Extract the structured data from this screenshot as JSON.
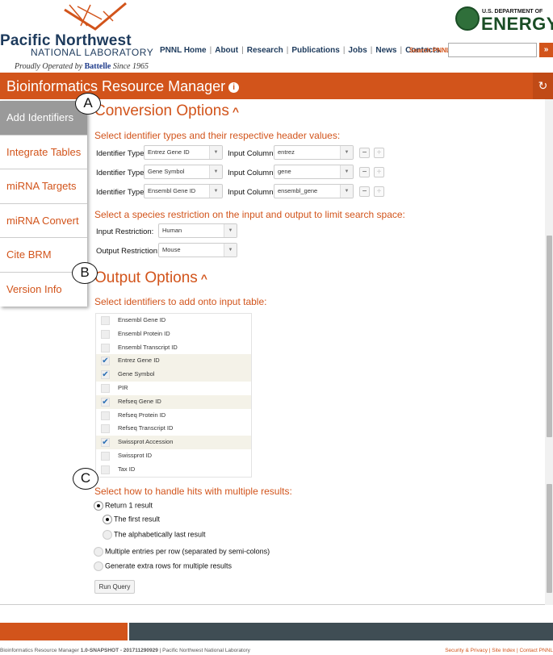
{
  "header": {
    "logo_title": "Pacific Northwest",
    "logo_subtitle": "NATIONAL LABORATORY",
    "operated_prefix": "Proudly Operated by",
    "operated_brand": "Battelle",
    "operated_suffix": "Since 1965",
    "doe_small": "U.S. DEPARTMENT OF",
    "doe_big": "ENERGY",
    "nav": [
      "PNNL Home",
      "About",
      "Research",
      "Publications",
      "Jobs",
      "News",
      "Contacts"
    ],
    "search_label": "Search PNNL",
    "search_value": "",
    "search_button": "»"
  },
  "app": {
    "title": "Bioinformatics Resource Manager",
    "info_icon": "i",
    "refresh_icon": "↻"
  },
  "sidebar": {
    "items": [
      "Add Identifiers",
      "Integrate Tables",
      "miRNA Targets",
      "miRNA Convert",
      "Cite BRM",
      "Version Info"
    ],
    "active": "Add Identifiers"
  },
  "conversion": {
    "title": "Conversion Options",
    "caret": "^",
    "instruction": "Select identifier types and their respective header values:",
    "type_label": "Identifier Type:",
    "column_label": "Input Column:",
    "rows": [
      {
        "type": "Entrez Gene ID",
        "column": "entrez"
      },
      {
        "type": "Gene Symbol",
        "column": "gene"
      },
      {
        "type": "Ensembl Gene ID",
        "column": "ensembl_gene"
      }
    ],
    "minus": "−",
    "plus": "+",
    "species_instruction": "Select a species restriction on the input and output to limit search space:",
    "input_restriction_label": "Input Restriction:",
    "input_restriction_value": "Human",
    "output_restriction_label": "Output Restriction:",
    "output_restriction_value": "Mouse"
  },
  "output": {
    "title": "Output Options",
    "caret": "^",
    "instruction": "Select identifiers to add onto input table:",
    "identifiers": [
      {
        "label": "Ensembl Gene ID",
        "checked": false
      },
      {
        "label": "Ensembl Protein ID",
        "checked": false
      },
      {
        "label": "Ensembl Transcript ID",
        "checked": false
      },
      {
        "label": "Entrez Gene ID",
        "checked": true
      },
      {
        "label": "Gene Symbol",
        "checked": true
      },
      {
        "label": "PIR",
        "checked": false
      },
      {
        "label": "Refseq Gene ID",
        "checked": true
      },
      {
        "label": "Refseq Protein ID",
        "checked": false
      },
      {
        "label": "Refseq Transcript ID",
        "checked": false
      },
      {
        "label": "Swissprot Accession",
        "checked": true
      },
      {
        "label": "Swissprot ID",
        "checked": false
      },
      {
        "label": "Tax ID",
        "checked": false
      }
    ],
    "checkmark": "✔",
    "multiple_instruction": "Select how to handle hits with multiple results:",
    "options": {
      "return_one": "Return 1 result",
      "first_result": "The first result",
      "alpha_last": "The alphabetically last result",
      "multiple_entries": "Multiple entries per row (separated by semi-colons)",
      "extra_rows": "Generate extra rows for multiple results"
    },
    "run_button": "Run Query"
  },
  "markers": [
    "A",
    "B",
    "C"
  ],
  "footer": {
    "left_prefix": "Bioinformatics Resource Manager ",
    "left_version": "1.0-SNAPSHOT - 201711290929",
    "left_suffix": " | Pacific Northwest National Laboratory",
    "right": "Security & Privacy | Site Index | Contact PNNL"
  },
  "colors": {
    "accent": "#d2541b",
    "navy": "#1d3a5c",
    "footer_dark": "#3f4d54",
    "sidebar_active": "#9a9a9a",
    "check_blue": "#2a6fb5"
  }
}
